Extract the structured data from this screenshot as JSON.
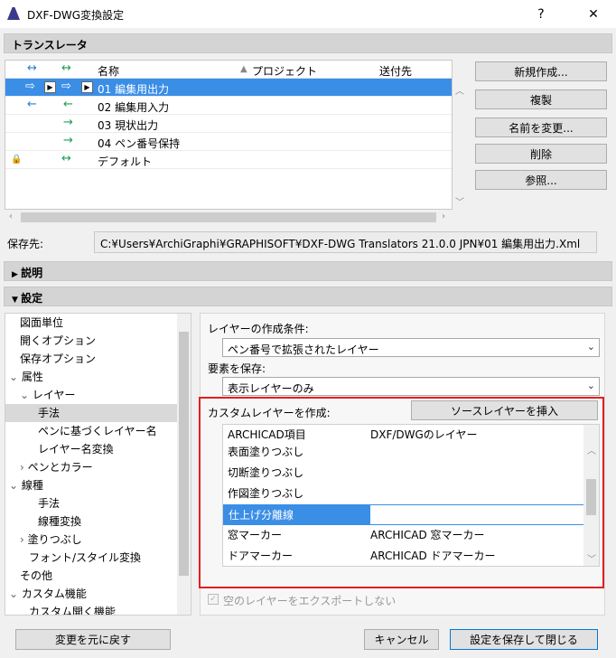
{
  "window": {
    "title": "DXF-DWG変換設定",
    "help_label": "?",
    "close_label": "✕"
  },
  "translator_section": {
    "header": "トランスレータ",
    "columns": {
      "name": "名称",
      "project": "プロジェクト",
      "sendto": "送付先"
    },
    "rows": [
      {
        "icon1": "⇨",
        "icon2": "⇨",
        "name": "01 編集用出力",
        "selected": true
      },
      {
        "icon1": "←",
        "icon2": "←",
        "name": "02 編集用入力"
      },
      {
        "icon1": "",
        "icon2": "→",
        "name": "03 現状出力"
      },
      {
        "icon1": "",
        "icon2": "→",
        "name": "04 ペン番号保持"
      },
      {
        "icon1": "🔒",
        "icon2": "↔",
        "name": "デフォルト"
      }
    ],
    "header_icons": {
      "icon1": "↔",
      "icon2": "↔"
    },
    "buttons": {
      "new": "新規作成...",
      "duplicate": "複製",
      "rename": "名前を変更...",
      "delete": "削除",
      "browse": "参照..."
    },
    "save_location_label": "保存先:",
    "save_location_path": "C:¥Users¥ArchiGraphi¥GRAPHISOFT¥DXF-DWG Translators 21.0.0 JPN¥01 編集用出力.Xml"
  },
  "description_section": {
    "header": "説明"
  },
  "settings_section": {
    "header": "設定"
  },
  "tree": [
    {
      "label": "図面単位"
    },
    {
      "label": "開くオプション"
    },
    {
      "label": "保存オプション"
    },
    {
      "label": "属性",
      "expander": "⌄"
    },
    {
      "label": "レイヤー",
      "expander": "⌄"
    },
    {
      "label": "手法",
      "selected": true
    },
    {
      "label": "ペンに基づくレイヤー名"
    },
    {
      "label": "レイヤー名変換"
    },
    {
      "label": "ペンとカラー",
      "expander": "›"
    },
    {
      "label": "線種",
      "expander": "⌄"
    },
    {
      "label": "手法"
    },
    {
      "label": "線種変換"
    },
    {
      "label": "塗りつぶし",
      "expander": "›"
    },
    {
      "label": "フォント/スタイル変換"
    },
    {
      "label": "その他"
    },
    {
      "label": "カスタム機能",
      "expander": "⌄"
    },
    {
      "label": "カスタム開く機能"
    }
  ],
  "panel": {
    "layer_condition_label": "レイヤーの作成条件:",
    "layer_condition_value": "ペン番号で拡張されたレイヤー",
    "save_elements_label": "要素を保存:",
    "save_elements_value": "表示レイヤーのみ",
    "custom_layer_label": "カスタムレイヤーを作成:",
    "insert_source_button": "ソースレイヤーを挿入",
    "layer_columns": {
      "item": "ARCHICAD項目",
      "layer": "DXF/DWGのレイヤー"
    },
    "layer_rows": [
      {
        "item": "表面塗りつぶし",
        "layer": ""
      },
      {
        "item": "切断塗りつぶし",
        "layer": ""
      },
      {
        "item": "作図塗りつぶし",
        "layer": ""
      },
      {
        "item": "仕上げ分離線",
        "layer": "",
        "editing": true
      },
      {
        "item": "窓マーカー",
        "layer": "ARCHICAD 窓マーカー"
      },
      {
        "item": "ドアマーカー",
        "layer": "ARCHICAD ドアマーカー"
      }
    ],
    "export_empty_layers_label": "空のレイヤーをエクスポートしない"
  },
  "footer": {
    "undo_button": "変更を元に戻す",
    "cancel_button": "キャンセル",
    "save_close_button": "設定を保存して閉じる"
  },
  "colors": {
    "selection": "#3a8ee6",
    "highlight_box": "#e02020"
  }
}
